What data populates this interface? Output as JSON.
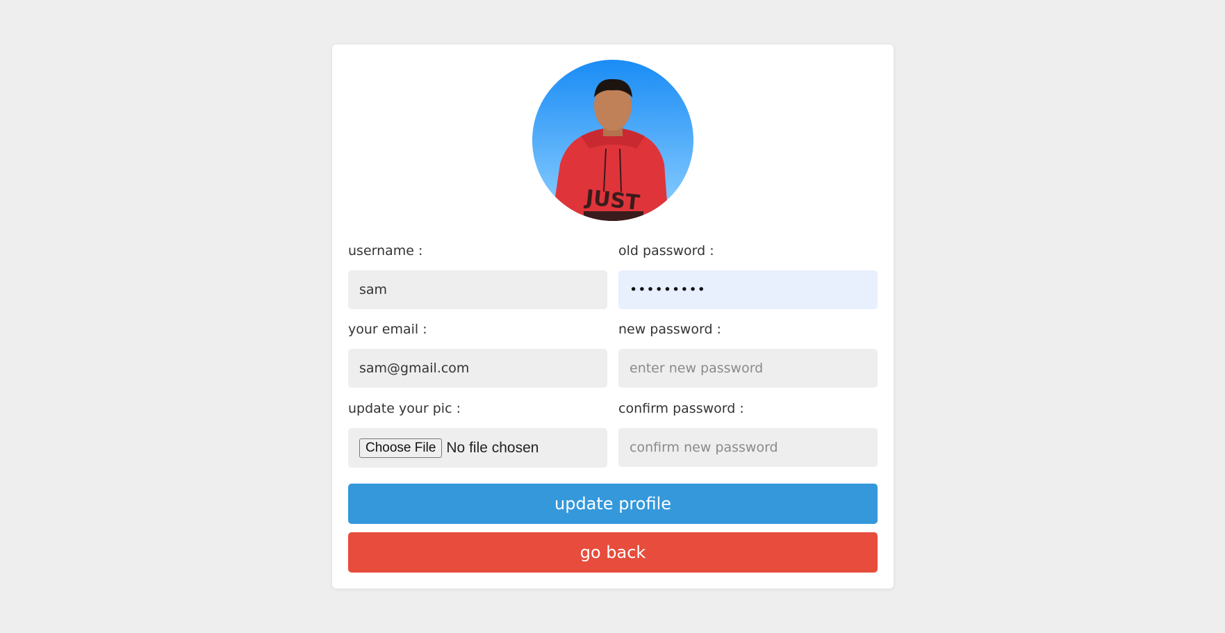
{
  "form": {
    "username_label": "username :",
    "username_value": "sam",
    "old_password_label": "old password :",
    "old_password_value": "sampasswd",
    "email_label": "your email :",
    "email_value": "sam@gmail.com",
    "new_password_label": "new password :",
    "new_password_placeholder": "enter new password",
    "pic_label": "update your pic :",
    "choose_file_label": "Choose File",
    "file_status": "No file chosen",
    "confirm_password_label": "confirm password :",
    "confirm_password_placeholder": "confirm new password"
  },
  "buttons": {
    "update_label": "update profile",
    "back_label": "go back"
  },
  "colors": {
    "background": "#eeeeee",
    "card": "#ffffff",
    "field": "#eeeeee",
    "field_active": "#e8f0fe",
    "primary": "#3498db",
    "danger": "#e74c3c"
  }
}
